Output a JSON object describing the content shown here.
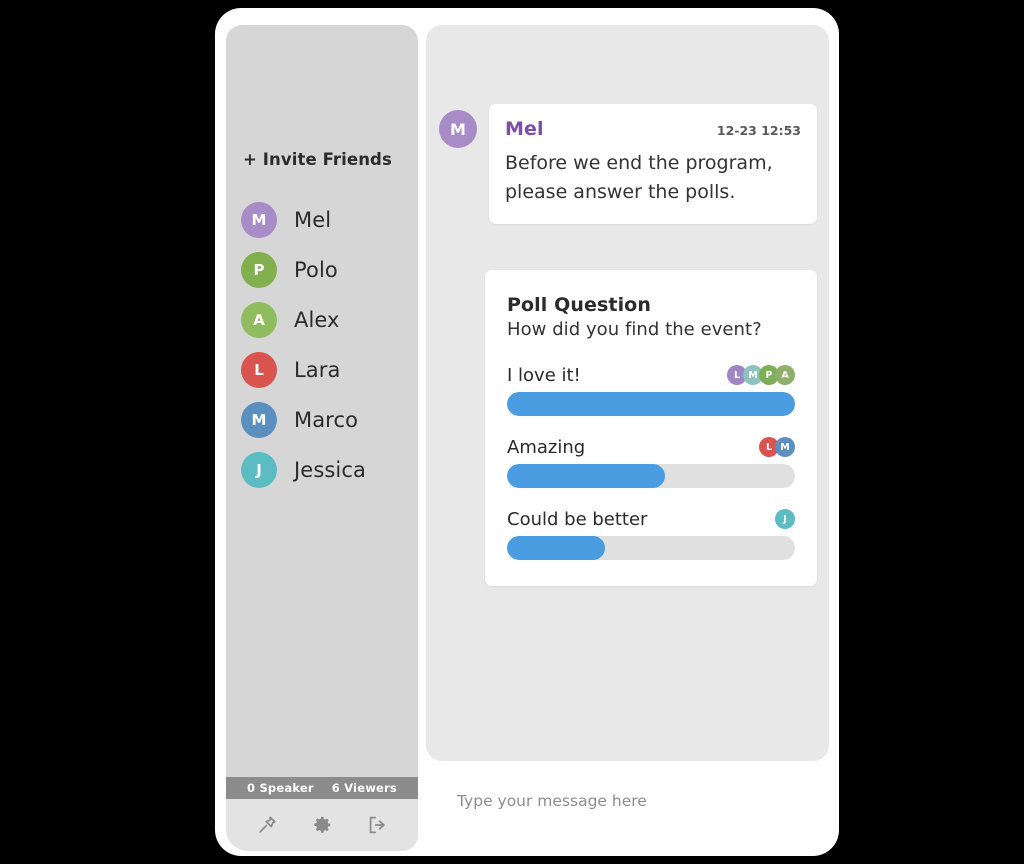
{
  "sidebar": {
    "invite_label": "+ Invite Friends",
    "members": [
      {
        "initial": "M",
        "name": "Mel",
        "color": "#a78cc8"
      },
      {
        "initial": "P",
        "name": "Polo",
        "color": "#82b04f"
      },
      {
        "initial": "A",
        "name": "Alex",
        "color": "#8fbc5f"
      },
      {
        "initial": "L",
        "name": "Lara",
        "color": "#d9534f"
      },
      {
        "initial": "M",
        "name": "Marco",
        "color": "#5b8fc0"
      },
      {
        "initial": "J",
        "name": "Jessica",
        "color": "#5bbcc4"
      }
    ],
    "status": {
      "speakers": "0 Speaker",
      "viewers": "6 Viewers"
    },
    "toolbar": [
      {
        "icon": "pin-icon"
      },
      {
        "icon": "gear-icon"
      },
      {
        "icon": "logout-icon"
      }
    ]
  },
  "chat": {
    "message": {
      "avatar_initial": "M",
      "avatar_color": "#a78cc8",
      "sender": "Mel",
      "sender_color": "#7b4fa8",
      "timestamp": "12-23 12:53",
      "text": "Before we end the program, please answer the polls."
    },
    "poll": {
      "title": "Poll Question",
      "question": "How did you find the event?",
      "bar_color": "#4a9de0",
      "track_color": "#e0e0e0",
      "options": [
        {
          "label": "I love it!",
          "percent": 100,
          "voters": [
            {
              "initial": "L",
              "color": "#9f86c4"
            },
            {
              "initial": "M",
              "color": "#8cc4bd"
            },
            {
              "initial": "P",
              "color": "#7fae58"
            },
            {
              "initial": "A",
              "color": "#8fb06a"
            }
          ]
        },
        {
          "label": "Amazing",
          "percent": 55,
          "voters": [
            {
              "initial": "L",
              "color": "#d9534f"
            },
            {
              "initial": "M",
              "color": "#5b8fc0"
            }
          ]
        },
        {
          "label": "Could be better",
          "percent": 34,
          "voters": [
            {
              "initial": "J",
              "color": "#5bbcc4"
            }
          ]
        }
      ]
    },
    "composer": {
      "placeholder": "Type your message here",
      "value": ""
    }
  }
}
